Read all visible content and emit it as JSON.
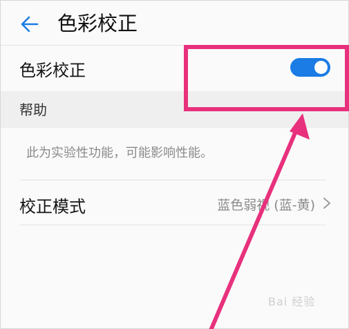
{
  "header": {
    "title": "色彩校正",
    "back_icon": "arrow-left-icon"
  },
  "color_correction_row": {
    "label": "色彩校正",
    "toggle_on": true
  },
  "help_section": {
    "label": "帮助",
    "text": "此为实验性功能，可能影响性能。"
  },
  "mode_row": {
    "label": "校正模式",
    "value": "蓝色弱视 (蓝-黄)",
    "chevron_icon": "chevron-right-icon"
  },
  "watermark": {
    "text": "Bai 经验"
  },
  "colors": {
    "accent": "#1a7ce4",
    "annotation": "#e8317c",
    "section_bg": "#efefef",
    "secondary_text": "#8a8a8a"
  }
}
